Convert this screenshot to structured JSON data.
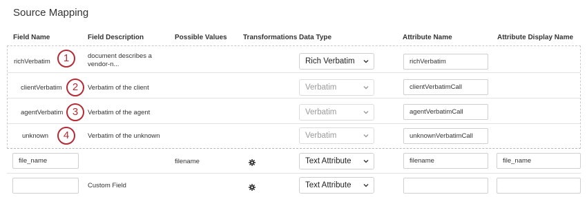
{
  "title": "Source Mapping",
  "columns": {
    "field_name": "Field Name",
    "field_description": "Field Description",
    "possible_values": "Possible Values",
    "transformations": "Transformations",
    "data_type": "Data Type",
    "attribute_name": "Attribute Name",
    "attribute_display_name": "Attribute Display Name"
  },
  "rows": [
    {
      "badge": "1",
      "field_name": "richVerbatim",
      "description": "document describes a vendor-n...",
      "data_type": "Rich Verbatim",
      "data_type_disabled": false,
      "attribute_name": "richVerbatim"
    },
    {
      "badge": "2",
      "field_name": "clientVerbatim",
      "description": "Verbatim of the client",
      "data_type": "Verbatim",
      "data_type_disabled": true,
      "attribute_name": "clientVerbatimCall"
    },
    {
      "badge": "3",
      "field_name": "agentVerbatim",
      "description": "Verbatim of the agent",
      "data_type": "Verbatim",
      "data_type_disabled": true,
      "attribute_name": "agentVerbatimCall"
    },
    {
      "badge": "4",
      "field_name": "unknown",
      "description": "Verbatim of the unknown",
      "data_type": "Verbatim",
      "data_type_disabled": true,
      "attribute_name": "unknownVerbatimCall"
    }
  ],
  "extra_rows": [
    {
      "field_name_value": "file_name",
      "description": "",
      "possible_values": "filename",
      "transformations_icon": "gear-icon",
      "data_type": "Text Attribute",
      "attribute_name": "filename",
      "attribute_display_name": "file_name"
    },
    {
      "field_name_value": "",
      "description": "Custom Field",
      "possible_values": "",
      "transformations_icon": "gear-icon",
      "data_type": "Text Attribute",
      "attribute_name": "",
      "attribute_display_name": ""
    }
  ],
  "colors": {
    "badge": "#b42a35",
    "border": "#cfcfcf",
    "disabled_text": "#9a9a9a"
  }
}
